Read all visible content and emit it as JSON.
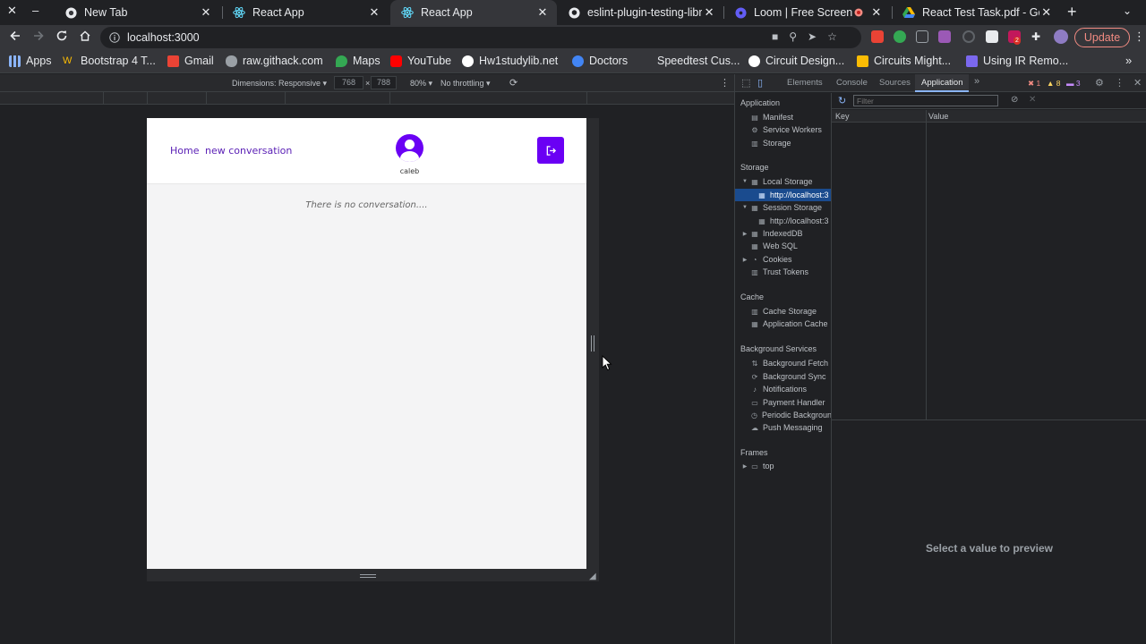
{
  "browser": {
    "window_controls": {
      "close": "✕",
      "minimize": "–"
    },
    "tabs": [
      {
        "title": "New Tab",
        "icon": "chrome-icon",
        "active": false
      },
      {
        "title": "React App",
        "icon": "react-icon",
        "active": false
      },
      {
        "title": "React App",
        "icon": "react-icon",
        "active": true
      },
      {
        "title": "eslint-plugin-testing-libr",
        "icon": "github-icon",
        "active": false
      },
      {
        "title": "Loom | Free Screen &",
        "icon": "loom-icon",
        "active": false
      },
      {
        "title": "React Test Task.pdf - Goo",
        "icon": "drive-icon",
        "active": false
      }
    ],
    "url": "localhost:3000",
    "update_label": "Update",
    "extension_badge": "2",
    "bookmarks": [
      {
        "label": "Apps",
        "icon": "apps-grid-icon",
        "color": "#8ab4f8"
      },
      {
        "label": "Bootstrap 4 T...",
        "icon": "bootstrap-icon",
        "color": "#e8eaed"
      },
      {
        "label": "Gmail",
        "icon": "gmail-icon",
        "color": "#ea4335"
      },
      {
        "label": "raw.githack.com",
        "icon": "githack-icon",
        "color": "#9aa0a6"
      },
      {
        "label": "Maps",
        "icon": "maps-icon",
        "color": "#34a853"
      },
      {
        "label": "YouTube",
        "icon": "youtube-icon",
        "color": "#ff0000"
      },
      {
        "label": "Hw1studylib.net",
        "icon": "google-icon",
        "color": "#ffffff"
      },
      {
        "label": "Doctors",
        "icon": "doctors-icon",
        "color": "#4285f4"
      },
      {
        "label": "Speedtest Cus...",
        "icon": "speedtest-icon",
        "color": "#35363a"
      },
      {
        "label": "Circuit Design...",
        "icon": "circuit-icon",
        "color": "#ffffff"
      },
      {
        "label": "Circuits Might...",
        "icon": "circuits-icon",
        "color": "#fbbc04"
      },
      {
        "label": "Using IR Remo...",
        "icon": "ir-icon",
        "color": "#7b68ee"
      }
    ]
  },
  "emulation": {
    "dimensions_label": "Dimensions: Responsive ▾",
    "width": "768",
    "times": "×",
    "height": "788",
    "zoom": "80% ▾",
    "throttling": "No throttling ▾"
  },
  "app": {
    "nav": {
      "home": "Home",
      "new_conversation": "new conversation"
    },
    "username": "caleb",
    "empty_message": "There is no conversation....",
    "accent": "#6a00f4"
  },
  "devtools": {
    "tabs": [
      "Elements",
      "Console",
      "Sources",
      "Application"
    ],
    "active_tab": "Application",
    "more": "»",
    "errors": "1",
    "warnings": "8",
    "issues": "3",
    "sidebar": {
      "application_header": "Application",
      "application_items": [
        "Manifest",
        "Service Workers",
        "Storage"
      ],
      "storage_header": "Storage",
      "local_storage": "Local Storage",
      "local_storage_origin": "http://localhost:3",
      "session_storage": "Session Storage",
      "session_storage_origin": "http://localhost:3",
      "storage_items": [
        "IndexedDB",
        "Web SQL",
        "Cookies",
        "Trust Tokens"
      ],
      "cache_header": "Cache",
      "cache_items": [
        "Cache Storage",
        "Application Cache"
      ],
      "background_header": "Background Services",
      "background_items": [
        "Background Fetch",
        "Background Sync",
        "Notifications",
        "Payment Handler",
        "Periodic Backgroun",
        "Push Messaging"
      ],
      "frames_header": "Frames",
      "frames_top": "top"
    },
    "filter_placeholder": "Filter",
    "columns": {
      "key": "Key",
      "value": "Value"
    },
    "preview_text": "Select a value to preview"
  }
}
